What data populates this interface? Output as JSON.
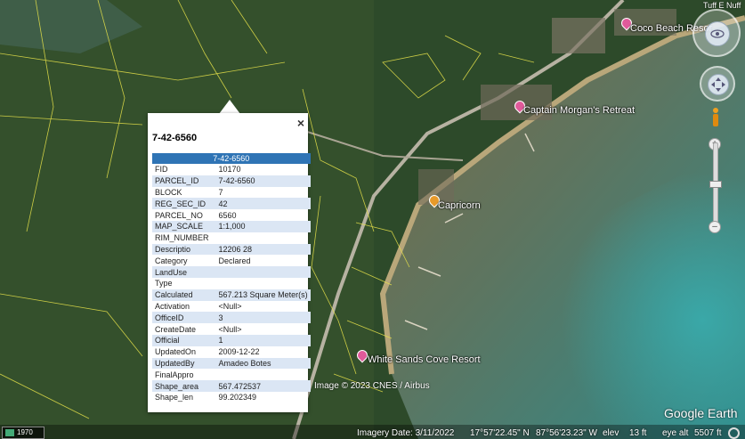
{
  "map": {
    "places": [
      {
        "name": "Coco Beach Resor"
      },
      {
        "name": "Captain Morgan's Retreat"
      },
      {
        "name": "Capricorn"
      },
      {
        "name": "White Sands Cove Resort"
      }
    ],
    "image_credit": "Image © 2023 CNES / Airbus",
    "brand": "Google Earth",
    "top_right_label": "Tuff E Nuff"
  },
  "status_bar": {
    "year": "1970",
    "imagery_date": "Imagery Date: 3/11/2022",
    "lat": "17°57'22.45\" N",
    "lon": "87°56'23.23\" W",
    "elev_label": "elev",
    "elev_value": "13 ft",
    "eye_alt_label": "eye alt",
    "eye_alt_value": "5507 ft"
  },
  "popup": {
    "title": "7-42-6560",
    "table_header": "7-42-6560",
    "close_symbol": "×",
    "rows": [
      {
        "field": "FID",
        "value": "10170"
      },
      {
        "field": "PARCEL_ID",
        "value": "7-42-6560"
      },
      {
        "field": "BLOCK",
        "value": "7"
      },
      {
        "field": "REG_SEC_ID",
        "value": "42"
      },
      {
        "field": "PARCEL_NO",
        "value": "6560"
      },
      {
        "field": "MAP_SCALE",
        "value": "1:1,000"
      },
      {
        "field": "RIM_NUMBER",
        "value": ""
      },
      {
        "field": "Descriptio",
        "value": "12206 28"
      },
      {
        "field": "Category",
        "value": "Declared"
      },
      {
        "field": "LandUse",
        "value": ""
      },
      {
        "field": "Type",
        "value": ""
      },
      {
        "field": "Calculated",
        "value": "567.213 Square Meter(s)"
      },
      {
        "field": "Activation",
        "value": "<Null>"
      },
      {
        "field": "OfficeID",
        "value": "3"
      },
      {
        "field": "CreateDate",
        "value": "<Null>"
      },
      {
        "field": "Official",
        "value": "1"
      },
      {
        "field": "UpdatedOn",
        "value": "2009-12-22"
      },
      {
        "field": "UpdatedBy",
        "value": "Amadeo Botes"
      },
      {
        "field": "FinalAppro",
        "value": ""
      },
      {
        "field": "Shape_area",
        "value": "567.472537"
      },
      {
        "field": "Shape_len",
        "value": "99.202349"
      }
    ]
  },
  "colors": {
    "header_blue": "#2f74b5",
    "row_alt": "#dbe6f4",
    "parcel_lines": "#e8e34a",
    "pin_pink": "#e05a9a",
    "pin_orange": "#e89a2a"
  },
  "icons": [
    "close-icon",
    "pegman-icon",
    "look-joystick-icon",
    "move-joystick-icon",
    "zoom-in-icon",
    "zoom-out-icon",
    "placemark-icon"
  ]
}
